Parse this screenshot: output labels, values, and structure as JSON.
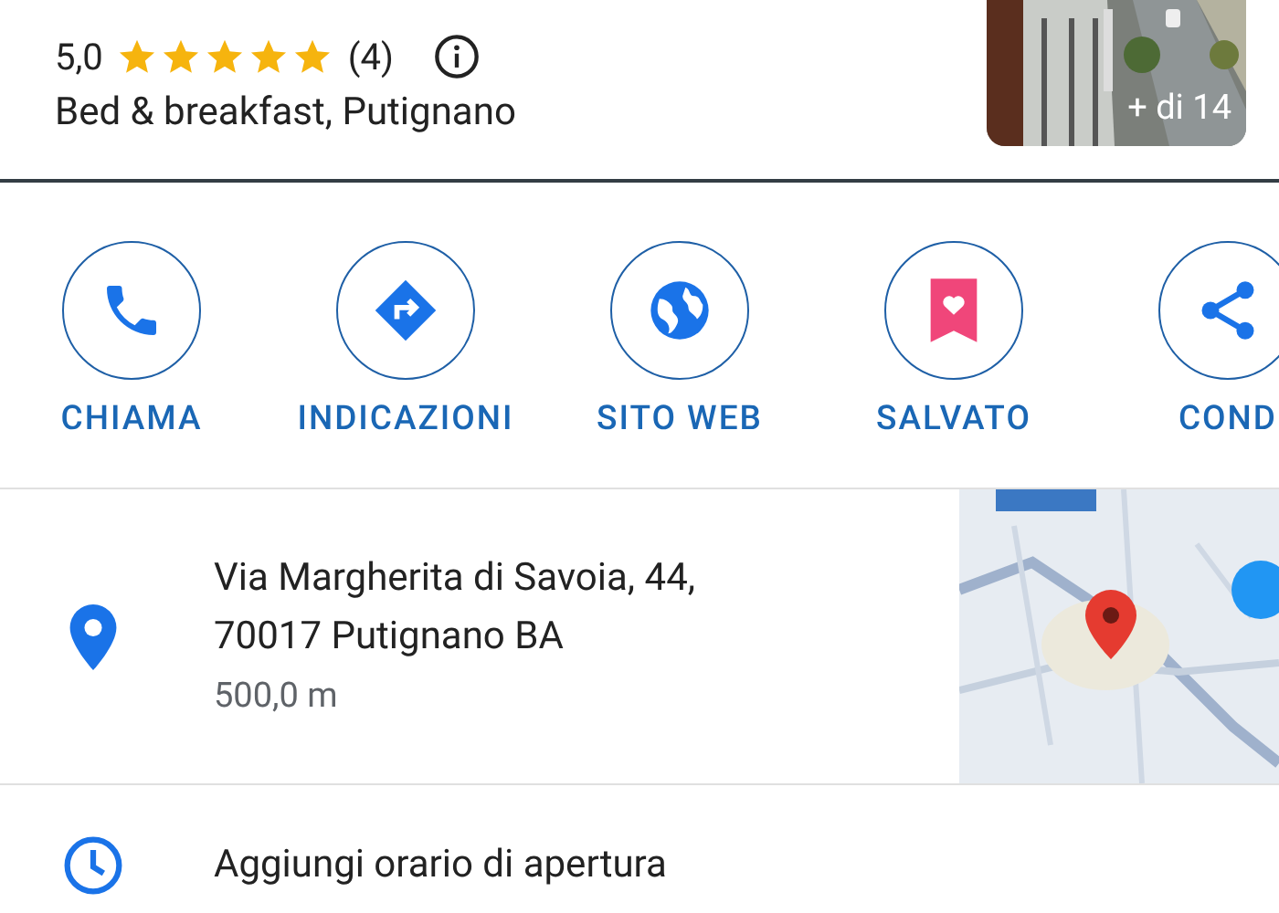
{
  "place": {
    "rating": "5,0",
    "stars": 5,
    "review_count": "(4)",
    "category": "Bed & breakfast, Putignano",
    "photo": {
      "kind": "picture",
      "count_label": "+ di 14"
    }
  },
  "actions": [
    {
      "kind": "call",
      "label": "CHIAMA"
    },
    {
      "kind": "directions",
      "label": "INDICAZIONI"
    },
    {
      "kind": "website",
      "label": "SITO WEB"
    },
    {
      "kind": "save",
      "label": "SALVATO"
    },
    {
      "kind": "share",
      "label": "COND"
    }
  ],
  "address": {
    "lines": [
      "Via Margherita di Savoia, 44,",
      "70017 Putignano BA"
    ],
    "distance": "500,0 m"
  },
  "hours": {
    "label": "Aggiungi orario di apertura"
  }
}
